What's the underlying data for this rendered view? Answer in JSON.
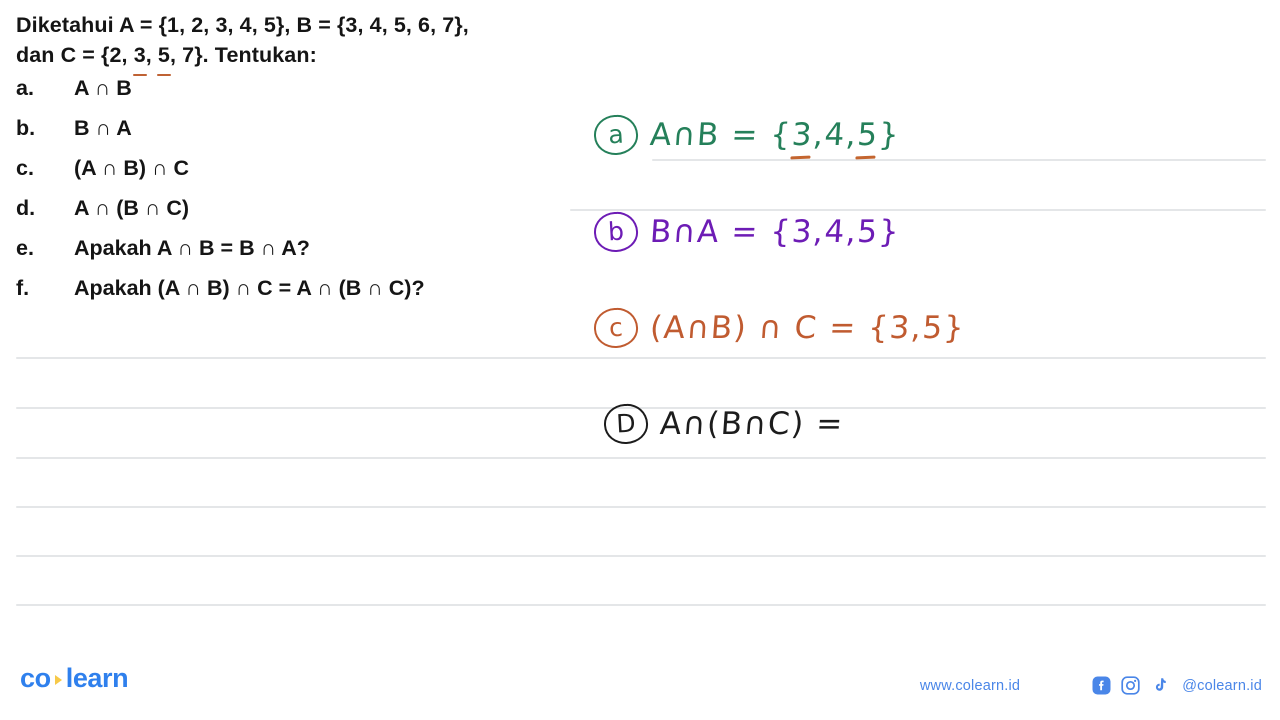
{
  "problem": {
    "statement_line1_prefix": "Diketahui A = {1, 2, 3, 4, 5}, B = {3, 4, 5, 6, 7},",
    "statement_line2_prefix": "dan C = {2, ",
    "statement_line2_u1": "3",
    "statement_line2_mid": ", ",
    "statement_line2_u2": "5",
    "statement_line2_suffix": ", 7}. Tentukan:",
    "items": [
      {
        "key": "a.",
        "text": "A ∩ B"
      },
      {
        "key": "b.",
        "text": "B ∩ A"
      },
      {
        "key": "c.",
        "text": "(A ∩ B) ∩ C"
      },
      {
        "key": "d.",
        "text": "A ∩ (B ∩ C)"
      },
      {
        "key": "e.",
        "text": "Apakah A ∩ B = B ∩ A?"
      },
      {
        "key": "f.",
        "text": "Apakah (A ∩ B) ∩ C = A ∩ (B ∩ C)?"
      }
    ]
  },
  "answers": [
    {
      "label": "a",
      "color": "#25805a",
      "expr": "A∩B = {",
      "val_u1": "3",
      "val_mid": ",4,",
      "val_u2": "5",
      "val_end": "}"
    },
    {
      "label": "b",
      "color": "#6d1cb5",
      "expr": "B∩A = {3,4,5}"
    },
    {
      "label": "c",
      "color": "#c05b30",
      "expr": "(A∩B) ∩ C = {3,5}"
    },
    {
      "label": "D",
      "color": "#1c1c1c",
      "expr": "A∩(B∩C) ="
    }
  ],
  "footer": {
    "logo_part1": "co",
    "logo_part2": "learn",
    "website": "www.colearn.id",
    "handle": "@colearn.id",
    "icons": [
      "facebook-icon",
      "instagram-icon",
      "tiktok-icon"
    ]
  },
  "colors": {
    "brand_blue": "#2f80ed",
    "accent_yellow": "#f7c948",
    "rule_gray": "#e4e6e8",
    "green_ink": "#25805a",
    "purple_ink": "#6d1cb5",
    "orange_ink": "#c05b30",
    "black_ink": "#1c1c1c"
  }
}
